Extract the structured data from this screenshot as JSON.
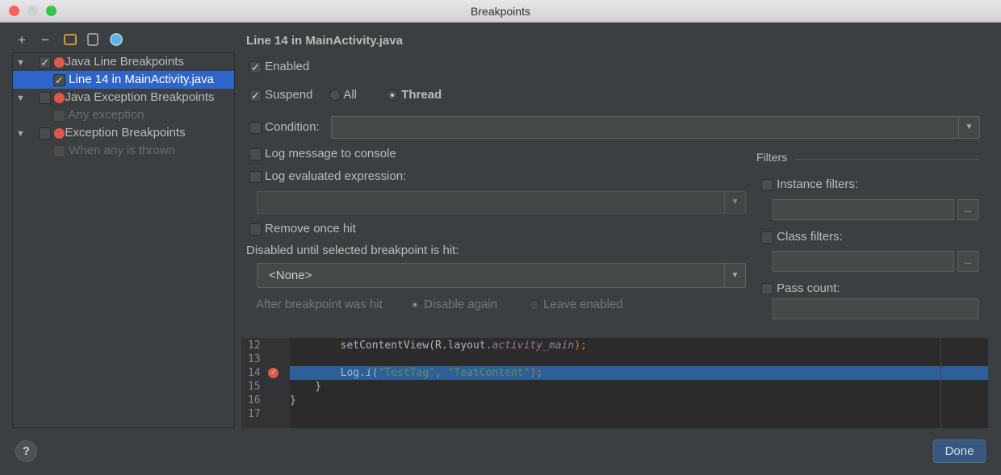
{
  "window": {
    "title": "Breakpoints"
  },
  "toolbar": {
    "add": "+",
    "remove": "−"
  },
  "tree": [
    {
      "label": "Java Line Breakpoints",
      "checked": true
    },
    {
      "label": "Line 14 in MainActivity.java",
      "checked": true
    },
    {
      "label": "Java Exception Breakpoints",
      "checked": false
    },
    {
      "label": "Any exception",
      "checked": false
    },
    {
      "label": "Exception Breakpoints",
      "checked": false
    },
    {
      "label": "When any is thrown",
      "checked": false
    }
  ],
  "detail": {
    "title": "Line 14 in MainActivity.java",
    "enabled": "Enabled",
    "suspend": "Suspend",
    "all": "All",
    "thread": "Thread",
    "condition": "Condition:",
    "log_message": "Log message to console",
    "log_expression": "Log evaluated expression:",
    "remove_once": "Remove once hit",
    "disabled_until": "Disabled until selected breakpoint is hit:",
    "none_option": "<None>",
    "after_hit": "After breakpoint was hit",
    "disable_again": "Disable again",
    "leave_enabled": "Leave enabled"
  },
  "filters": {
    "title": "Filters",
    "instance": "Instance filters:",
    "class": "Class filters:",
    "pass": "Pass count:",
    "more": "..."
  },
  "code": {
    "lines": [
      "12",
      "13",
      "14",
      "15",
      "16",
      "17"
    ],
    "l12a": "        setContentView(R.layout.",
    "l12b": "activity_main",
    "l12c": ");",
    "l14a": "        Log.",
    "l14b": "i",
    "l14c": "(",
    "l14d": "\"TestTag\"",
    "l14e": ", ",
    "l14f": "\"TeatContent\"",
    "l14g": ");",
    "l15": "    }",
    "l16": "}"
  },
  "footer": {
    "help": "?",
    "done": "Done"
  }
}
